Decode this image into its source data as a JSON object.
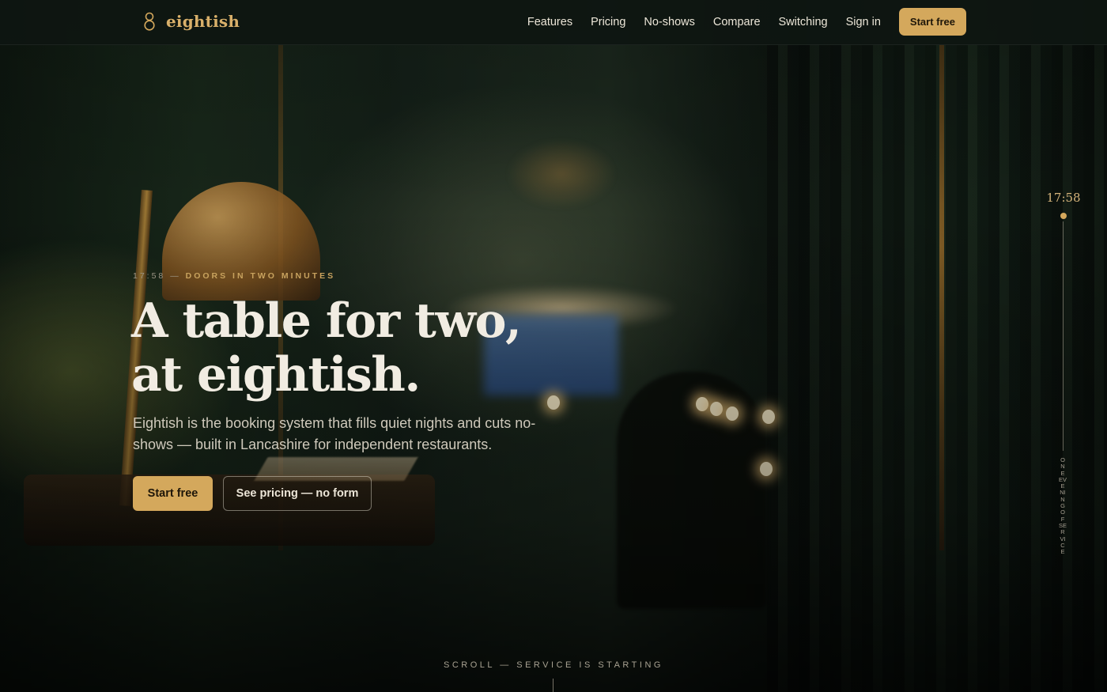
{
  "brand": {
    "name": "eightish",
    "icon": "figure-eight-icon",
    "color": "#d9b06a"
  },
  "nav": {
    "links": [
      "Features",
      "Pricing",
      "No-shows",
      "Compare",
      "Switching",
      "Sign in"
    ],
    "cta": "Start free"
  },
  "hero": {
    "eyebrow_time": "17:58",
    "eyebrow_sep": "—",
    "eyebrow_msg": "DOORS IN TWO MINUTES",
    "headline_line1": "A table for two,",
    "headline_line2": "at eightish.",
    "subtitle": "Eightish is the booking system that fills quiet nights and cuts no-shows — built in Lancashire for independent restaurants.",
    "primary_button": "Start free",
    "secondary_button": "See pricing — no form"
  },
  "timeline": {
    "clock": "17:58",
    "vertical_label": "ONE EVENING OF SERVICE"
  },
  "scroll_cue": "SCROLL — SERVICE IS STARTING",
  "colors": {
    "accent": "#d4a85c",
    "background": "#0e1510"
  }
}
